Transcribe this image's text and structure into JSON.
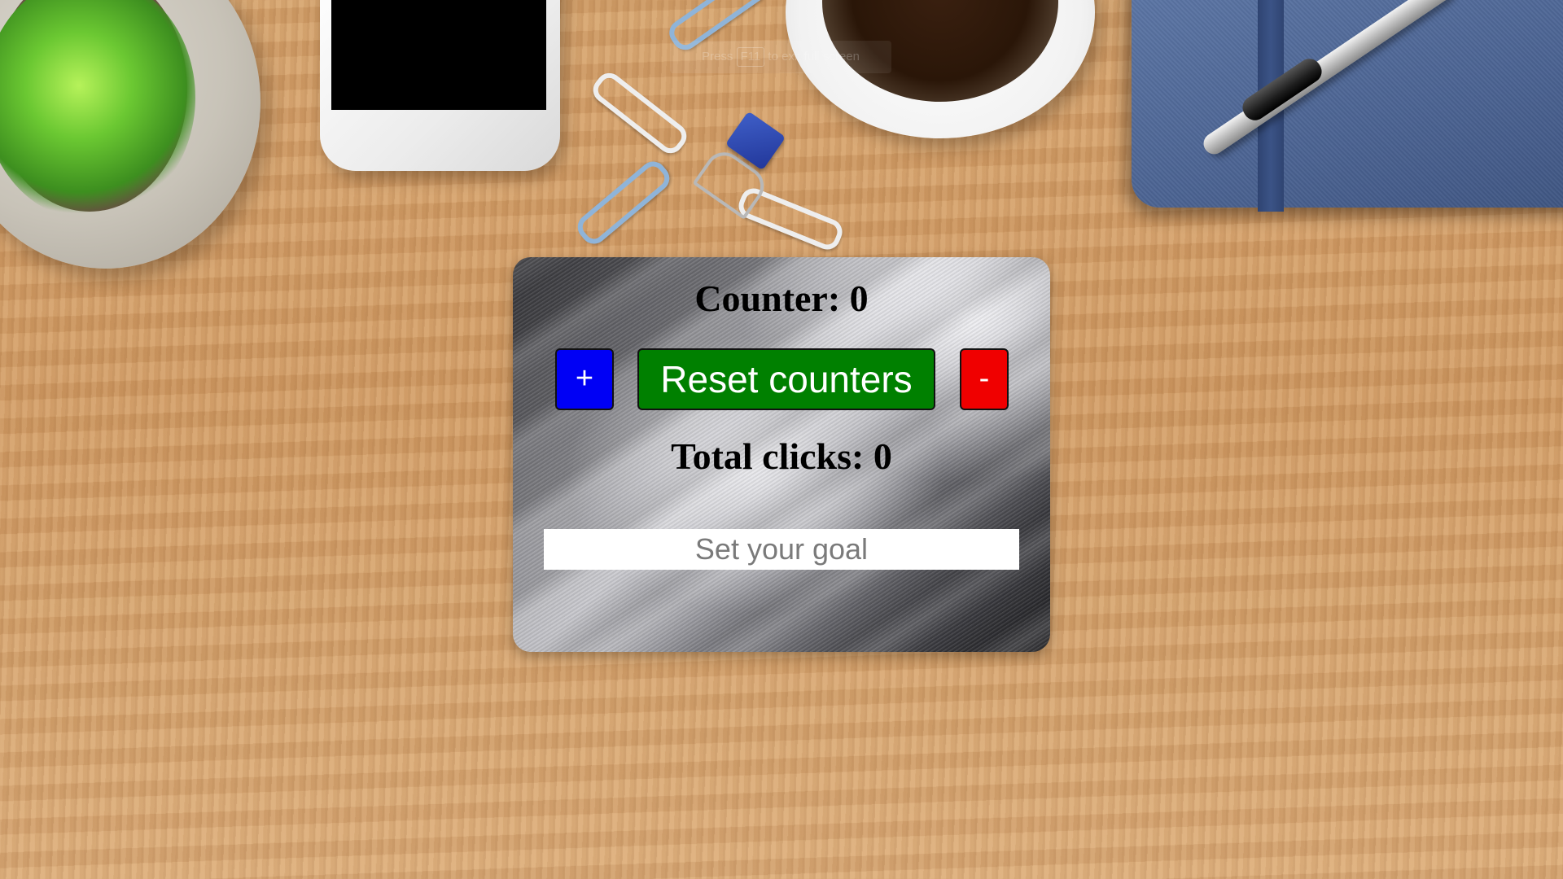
{
  "overlay_hint": {
    "text_before": "Press",
    "key": "F11",
    "text_after": "to exit full screen"
  },
  "counter": {
    "text": "Counter: 0",
    "value": 0
  },
  "buttons": {
    "increment_label": "+",
    "reset_label": "Reset counters",
    "decrement_label": "-"
  },
  "total": {
    "text": "Total clicks: 0",
    "value": 0
  },
  "goal": {
    "placeholder": "Set your goal",
    "value": ""
  },
  "colors": {
    "increment_button": "#0000f5",
    "reset_button": "#008000",
    "decrement_button": "#f00000"
  },
  "background": {
    "scene": "wooden desk with succulent plant, smartphone, paper clips, binder clip, coffee cup, blue notebook and pen"
  }
}
